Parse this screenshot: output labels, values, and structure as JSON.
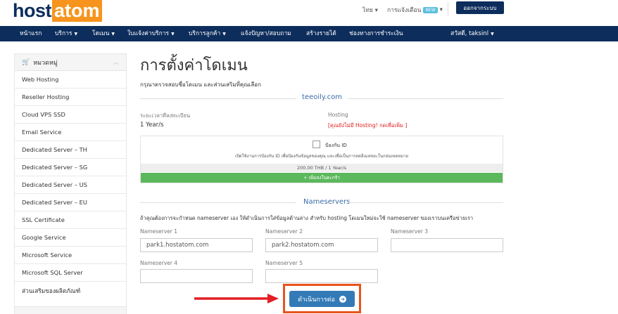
{
  "brand": {
    "part1": "host",
    "part2": "atom"
  },
  "topbar": {
    "language": "ไทย",
    "notifications": "การแจ้งเตือน",
    "badge": "NEW",
    "logout": "ออกจากระบบ"
  },
  "nav": {
    "items": [
      {
        "label": "หน้าแรก",
        "dropdown": false
      },
      {
        "label": "บริการ",
        "dropdown": true
      },
      {
        "label": "โดเมน",
        "dropdown": true
      },
      {
        "label": "ใบแจ้งค่าบริการ",
        "dropdown": true
      },
      {
        "label": "บริการลูกค้า",
        "dropdown": true
      },
      {
        "label": "แจ้งปัญหา/สอบถาม",
        "dropdown": false
      },
      {
        "label": "สร้างรายได้",
        "dropdown": false
      },
      {
        "label": "ช่องทางการชำระเงิน",
        "dropdown": false
      }
    ],
    "user": "สวัสดี, taksinl"
  },
  "sidebar": {
    "heading": "หมวดหมู่",
    "items": [
      "Web Hosting",
      "Reseller Hosting",
      "Cloud VPS SSD",
      "Email Service",
      "Dedicated Server – TH",
      "Dedicated Server – SG",
      "Dedicated Server – US",
      "Dedicated Server – EU",
      "SSL Certificate",
      "Google Service",
      "Microsoft Service",
      "Microsoft SQL Server",
      "ส่วนเสริมของผลิตภัณฑ์"
    ]
  },
  "main": {
    "title": "การตั้งค่าโดเมน",
    "subtitle": "กรุณาตรวจสอบชื่อโดเมน และส่วนเสริมที่คุณเลือก",
    "domain": "teeoily.com",
    "period_label": "ระยะเวลาที่ลงทะเบียน",
    "period_value": "1 Year/s",
    "hosting_label": "Hosting",
    "hosting_value": "[คุณยังไม่มี Hosting! กดเพื่อเพิ่ม ]",
    "protection": {
      "label": "ป้องกัน ID",
      "description": "เปิดใช้งานการป้องกัน ID เพื่อป้องกันข้อมูลของคุณ และเพื่อเป็นการลดอีเมลขยะในกล่องจดหมาย",
      "price": "200.00 THB / 1 Year/s",
      "add_button": "+ เพิ่มลงในตะกร้า"
    },
    "nameservers_heading": "Nameservers",
    "nameservers_desc": "ถ้าคุณต้องการจะกำหนด nameserver เอง ให้ดำเนินการใส่ข้อมูลด้านล่าง สำหรับ hosting โดเมนใหม่จะใช้ nameserver ของเราบนเครือข่ายเรา",
    "ns": [
      {
        "label": "Nameserver 1",
        "value": "park1.hostatom.com"
      },
      {
        "label": "Nameserver 2",
        "value": "park2.hostatom.com"
      },
      {
        "label": "Nameserver 3",
        "value": ""
      },
      {
        "label": "Nameserver 4",
        "value": ""
      },
      {
        "label": "Nameserver 5",
        "value": ""
      }
    ],
    "continue_button": "ดำเนินการต่อ"
  },
  "colors": {
    "navy": "#0d2d5c",
    "orange": "#f7941d",
    "highlight": "#e8541e",
    "arrow": "#e31e24",
    "green": "#5cb85c",
    "blue": "#337ab7"
  }
}
